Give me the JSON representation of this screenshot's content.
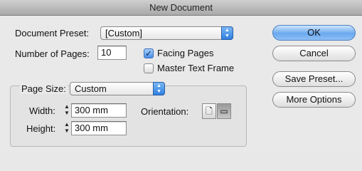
{
  "window": {
    "title": "New Document"
  },
  "document_preset": {
    "label": "Document Preset:",
    "value": "[Custom]"
  },
  "pages": {
    "label": "Number of Pages:",
    "value": "10"
  },
  "facing_pages": {
    "label": "Facing Pages",
    "checked": true
  },
  "master_text_frame": {
    "label": "Master Text Frame",
    "checked": false
  },
  "page_size": {
    "label": "Page Size:",
    "value": "Custom"
  },
  "width": {
    "label": "Width:",
    "value": "300 mm"
  },
  "height": {
    "label": "Height:",
    "value": "300 mm"
  },
  "orientation": {
    "label": "Orientation:",
    "selected": "landscape"
  },
  "buttons": {
    "ok": "OK",
    "cancel": "Cancel",
    "save_preset": "Save Preset...",
    "more_options": "More Options"
  },
  "icons": {
    "popup_arrows": "updown-arrows-icon",
    "stepper": "stepper-icon",
    "checkmark": "checkmark-icon",
    "portrait": "portrait-orientation-icon",
    "landscape": "landscape-orientation-icon"
  }
}
